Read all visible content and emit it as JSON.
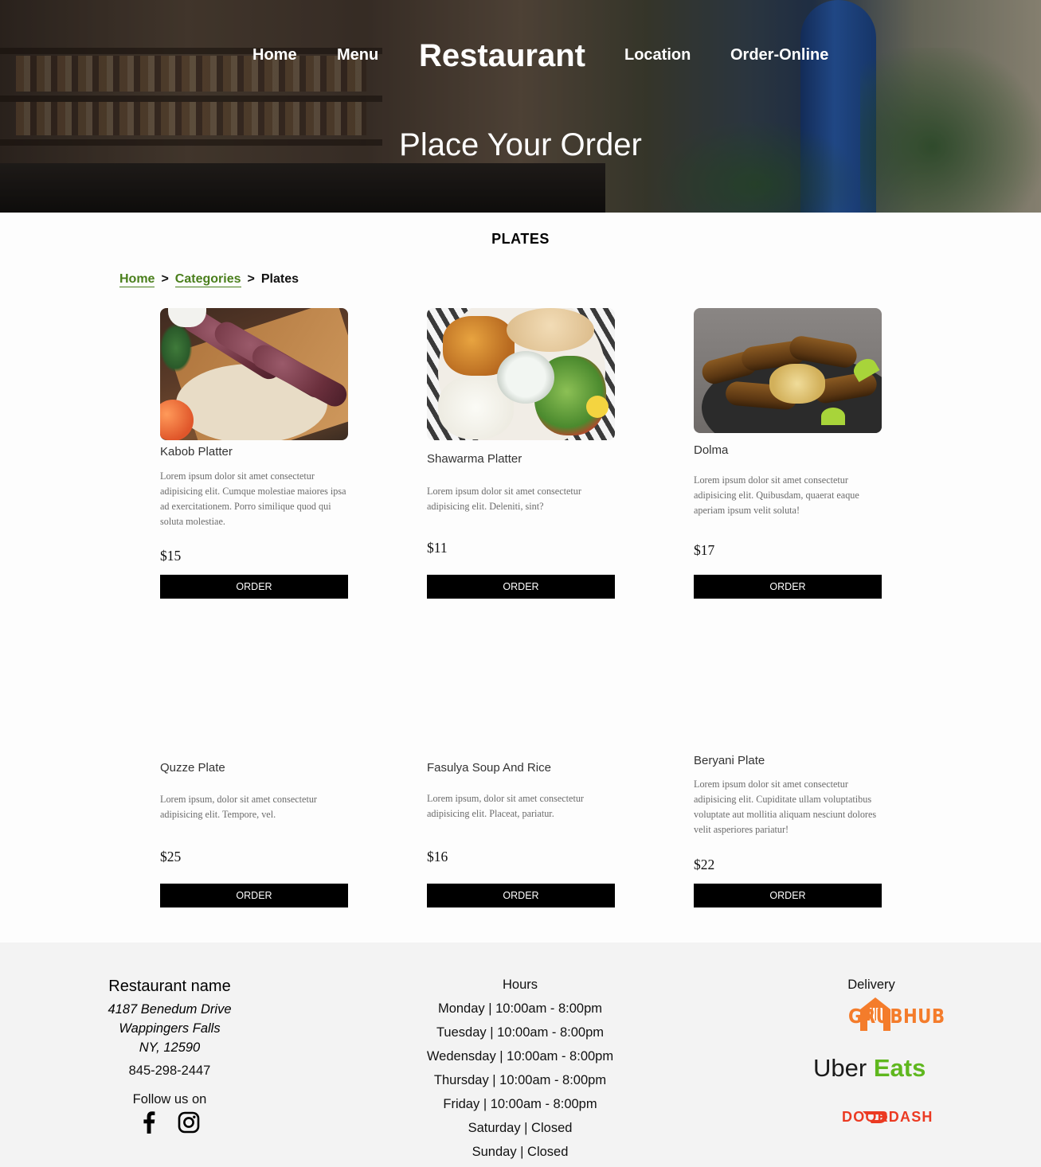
{
  "nav": {
    "home": "Home",
    "menu": "Menu",
    "brand": "Restaurant",
    "location": "Location",
    "order_online": "Order-Online"
  },
  "hero": {
    "title": "Place Your Order"
  },
  "section": {
    "title": "PLATES"
  },
  "breadcrumb": {
    "home": "Home",
    "sep": ">",
    "categories": "Categories",
    "current": "Plates"
  },
  "items": [
    {
      "name": "Kabob Platter",
      "description": "Lorem ipsum dolor sit amet consectetur adipisicing elit. Cumque molestiae maiores ipsa ad exercitationem. Porro similique quod qui soluta molestiae.",
      "price": "$15",
      "button": "ORDER"
    },
    {
      "name": "Shawarma Platter",
      "description": "Lorem ipsum dolor sit amet consectetur adipisicing elit. Deleniti, sint?",
      "price": "$11",
      "button": "ORDER"
    },
    {
      "name": "Dolma",
      "description": "Lorem ipsum dolor sit amet consectetur adipisicing elit. Quibusdam, quaerat eaque aperiam ipsum velit soluta!",
      "price": "$17",
      "button": "ORDER"
    },
    {
      "name": "Quzze Plate",
      "description": "Lorem ipsum, dolor sit amet consectetur adipisicing elit. Tempore, vel.",
      "price": "$25",
      "button": "ORDER"
    },
    {
      "name": "Fasulya Soup And Rice",
      "description": "Lorem ipsum, dolor sit amet consectetur adipisicing elit. Placeat, pariatur.",
      "price": "$16",
      "button": "ORDER"
    },
    {
      "name": "Beryani Plate",
      "description": "Lorem ipsum dolor sit amet consectetur adipisicing elit. Cupiditate ullam voluptatibus voluptate aut mollitia aliquam nesciunt dolores velit asperiores pariatur!",
      "price": "$22",
      "button": "ORDER"
    }
  ],
  "footer": {
    "restaurant_name": "Restaurant name",
    "address_line1": "4187 Benedum Drive",
    "address_line2": "Wappingers Falls",
    "address_line3": "NY, 12590",
    "phone": "845-298-2447",
    "follow": "Follow us on",
    "hours_title": "Hours",
    "hours": [
      "Monday | 10:00am - 8:00pm",
      "Tuesday | 10:00am - 8:00pm",
      "Wedensday | 10:00am - 8:00pm",
      "Thursday | 10:00am - 8:00pm",
      "Friday | 10:00am - 8:00pm",
      "Saturday | Closed",
      "Sunday | Closed"
    ],
    "delivery_title": "Delivery",
    "grubhub": "GRUBHUB",
    "uber": "Uber",
    "eats": "Eats",
    "doordash": "DOORDASH"
  },
  "colors": {
    "link_green": "#4a7f1c",
    "button_black": "#000000",
    "footer_bg": "#f3f3f3",
    "grubhub_orange": "#f47c2b",
    "ubereats_green": "#5fb71e",
    "doordash_red": "#eb3a22"
  },
  "icons": {
    "facebook": "facebook-icon",
    "instagram": "instagram-icon",
    "grubhub": "grubhub-logo",
    "doordash": "doordash-logo"
  }
}
